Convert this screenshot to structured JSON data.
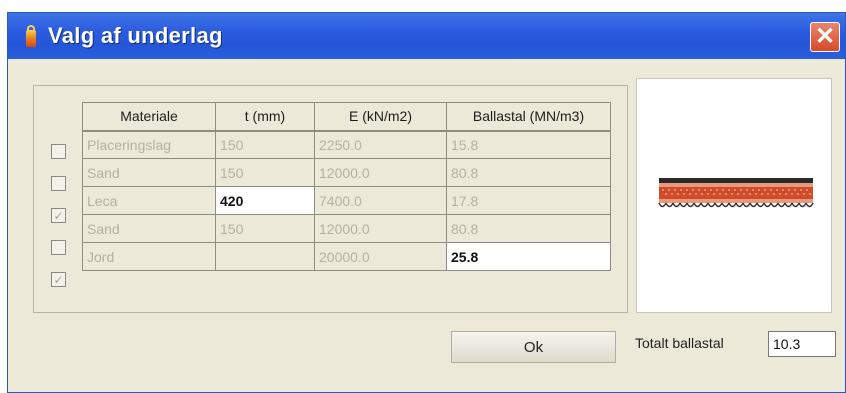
{
  "window": {
    "title": "Valg af underlag",
    "close_glyph": "✕"
  },
  "table": {
    "headers": [
      "Materiale",
      "t (mm)",
      "E (kN/m2)",
      "Ballastal (MN/m3)"
    ],
    "rows": [
      {
        "checked": false,
        "material": "Placeringslag",
        "t": "150",
        "e": "2250.0",
        "ballast": "15.8"
      },
      {
        "checked": false,
        "material": "Sand",
        "t": "150",
        "e": "12000.0",
        "ballast": "80.8"
      },
      {
        "checked": true,
        "material": "Leca",
        "t": "420",
        "e": "7400.0",
        "ballast": "17.8"
      },
      {
        "checked": false,
        "material": "Sand",
        "t": "150",
        "e": "12000.0",
        "ballast": "80.8"
      },
      {
        "checked": true,
        "material": "Jord",
        "t": "",
        "e": "20000.0",
        "ballast": "25.8"
      }
    ]
  },
  "buttons": {
    "ok_label": "Ok"
  },
  "total": {
    "label": "Totalt ballastal",
    "value": "10.3"
  },
  "colors": {
    "titlebar": "#2b5ce0",
    "dialog_bg": "#ece9d8",
    "close_button": "#d74a2a"
  }
}
